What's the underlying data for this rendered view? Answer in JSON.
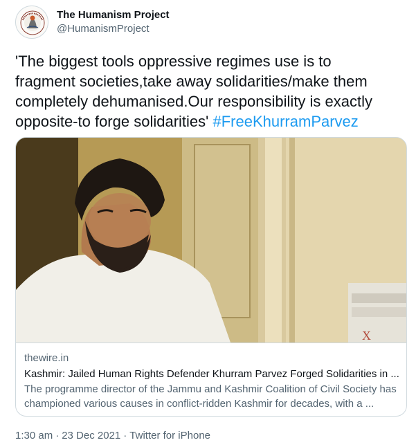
{
  "author": {
    "display_name": "The Humanism Project",
    "handle": "@HumanismProject",
    "avatar_logo_text": "THE HUMANISM PROJECT"
  },
  "tweet": {
    "text": "'The biggest tools oppressive regimes use is to\nfragment societies,take away solidarities/make them\ncompletely dehumanised.Our responsibility is exactly\nopposite-to forge solidarities'",
    "hashtag": "#FreeKhurramParvez"
  },
  "card": {
    "domain": "thewire.in",
    "title": "Kashmir: Jailed Human Rights Defender Khurram Parvez Forged Solidarities in ...",
    "description": "The programme director of the Jammu and Kashmir Coalition of Civil Society has championed various causes in conflict-ridden Kashmir for decades, with a ..."
  },
  "meta": {
    "time": "1:30 am",
    "date": "23 Dec 2021",
    "source": "Twitter for iPhone",
    "separator": "·"
  },
  "colors": {
    "text": "#0f1419",
    "secondary": "#536471",
    "link": "#1d9bf0",
    "border": "#cfd9de"
  }
}
